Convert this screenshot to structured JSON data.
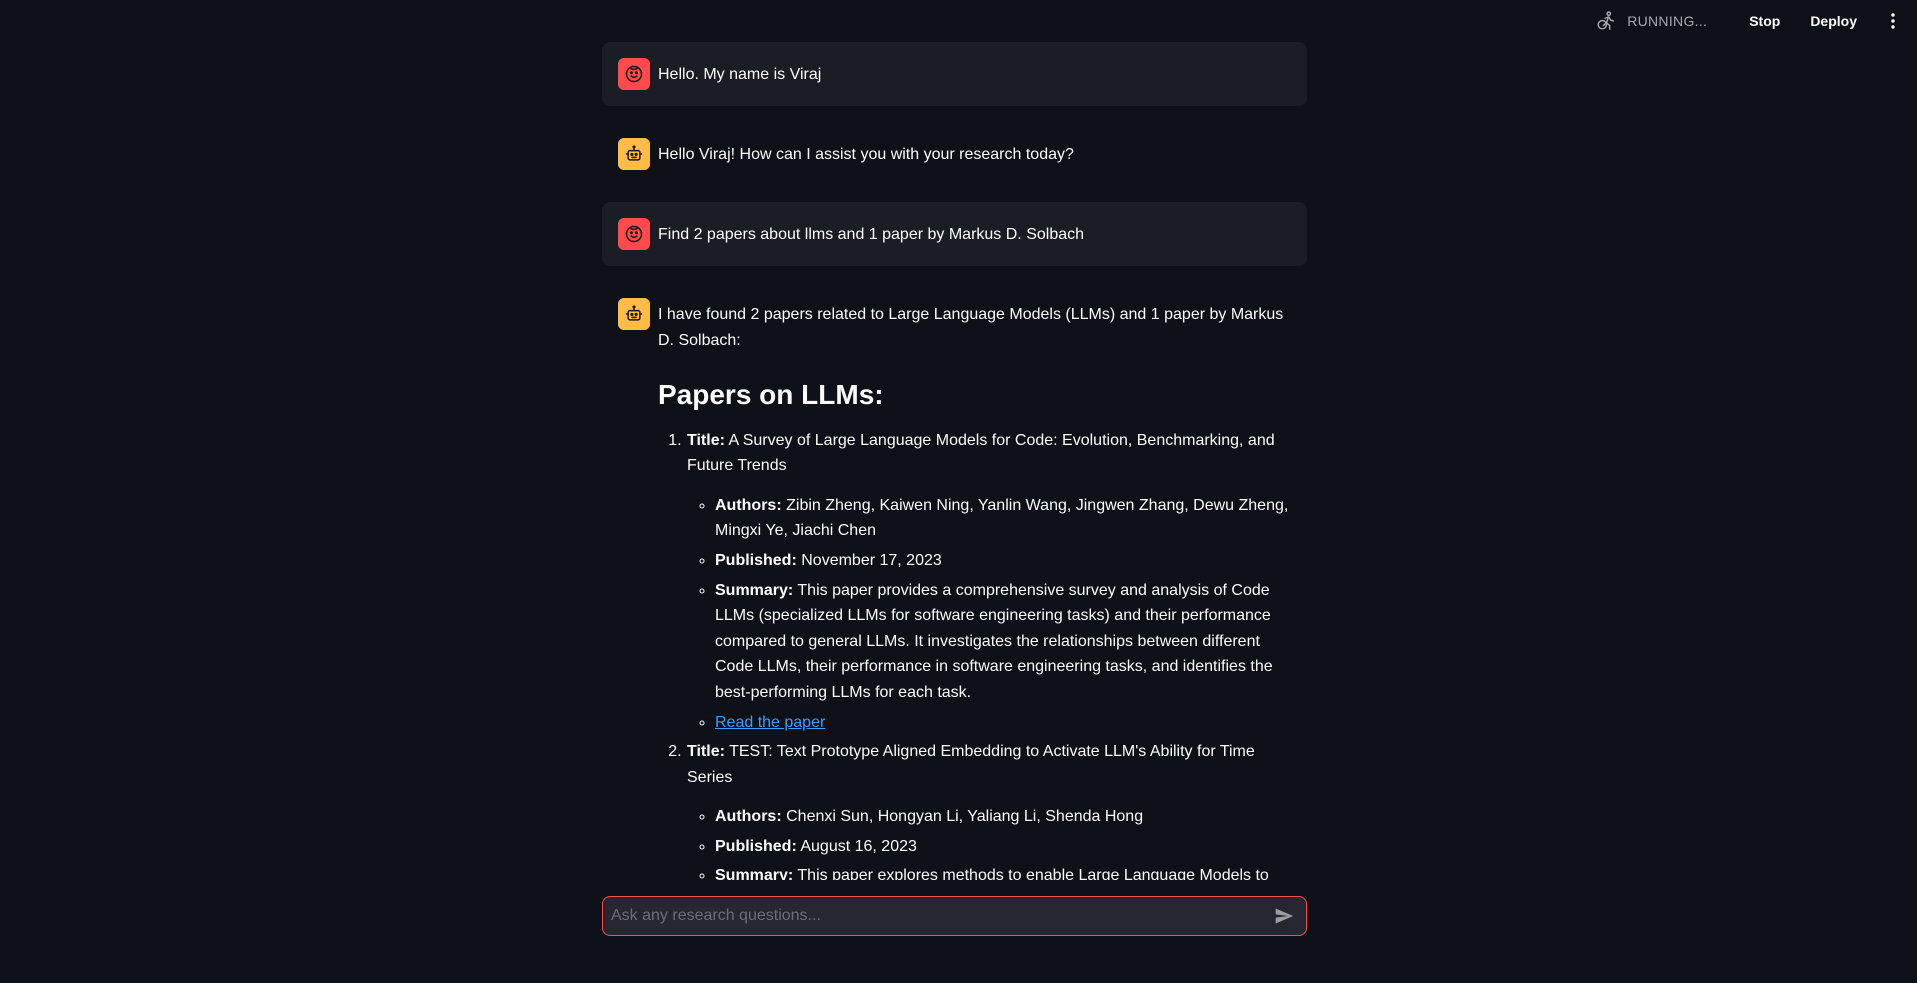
{
  "header": {
    "status_text": "RUNNING...",
    "stop_label": "Stop",
    "deploy_label": "Deploy"
  },
  "messages": [
    {
      "role": "user",
      "text": "Hello. My name is Viraj"
    },
    {
      "role": "assistant",
      "text": "Hello Viraj! How can I assist you with your research today?"
    },
    {
      "role": "user",
      "text": "Find 2 papers about llms and 1 paper by Markus D. Solbach"
    }
  ],
  "response": {
    "intro": "I have found 2 papers related to Large Language Models (LLMs) and 1 paper by Markus D. Solbach:",
    "section_title": "Papers on LLMs:",
    "papers": [
      {
        "title_label": "Title:",
        "title": "A Survey of Large Language Models for Code: Evolution, Benchmarking, and Future Trends",
        "authors_label": "Authors:",
        "authors": "Zibin Zheng, Kaiwen Ning, Yanlin Wang, Jingwen Zhang, Dewu Zheng, Mingxi Ye, Jiachi Chen",
        "published_label": "Published:",
        "published": "November 17, 2023",
        "summary_label": "Summary:",
        "summary": "This paper provides a comprehensive survey and analysis of Code LLMs (specialized LLMs for software engineering tasks) and their performance compared to general LLMs. It investigates the relationships between different Code LLMs, their performance in software engineering tasks, and identifies the best-performing LLMs for each task.",
        "link_text": "Read the paper"
      },
      {
        "title_label": "Title:",
        "title": "TEST: Text Prototype Aligned Embedding to Activate LLM's Ability for Time Series",
        "authors_label": "Authors:",
        "authors": "Chenxi Sun, Hongyan Li, Yaliang Li, Shenda Hong",
        "published_label": "Published:",
        "published": "August 16, 2023",
        "summary_label": "Summary:",
        "summary": "This paper explores methods to enable Large Language Models to handle Time-Series (TS) tasks by designing a TS embedding method named TEST. The proposed method aligns the TS embedding space with the LLM embedding layer space, enabling"
      }
    ]
  },
  "input": {
    "placeholder": "Ask any research questions..."
  },
  "colors": {
    "background": "#0e1117",
    "user_avatar": "#ff4b4b",
    "bot_avatar": "#ffbd45",
    "link": "#3b9dff",
    "input_border": "#ff4b4b"
  },
  "icons": {
    "status": "running-person-icon",
    "menu": "kebab-menu-icon",
    "user_avatar": "smiley-face-icon",
    "bot_avatar": "robot-icon",
    "send": "send-icon"
  }
}
